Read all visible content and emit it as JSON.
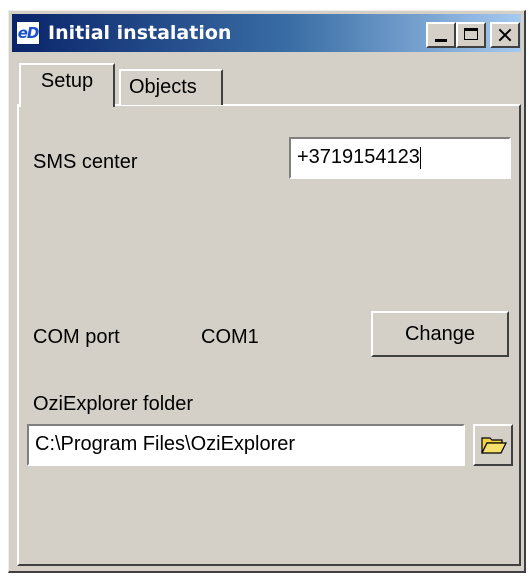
{
  "window": {
    "title": "Initial instalation",
    "app_icon_text": "eD",
    "buttons": {
      "minimize": "minimize",
      "maximize": "maximize",
      "close": "close"
    }
  },
  "tabs": [
    {
      "label": "Setup",
      "active": true
    },
    {
      "label": "Objects",
      "active": false
    }
  ],
  "setup": {
    "sms_center_label": "SMS center",
    "sms_center_value": "+3719154123",
    "com_port_label": "COM port",
    "com_port_value": "COM1",
    "change_button": "Change",
    "ozi_folder_label": "OziExplorer folder",
    "ozi_folder_value": "C:\\Program Files\\OziExplorer",
    "browse_icon": "folder-open-icon"
  },
  "colors": {
    "window_bg": "#d4d0c8",
    "title_bar_start": "#0a246a",
    "title_bar_end": "#a6caf0",
    "folder_icon": "#f2d047"
  }
}
